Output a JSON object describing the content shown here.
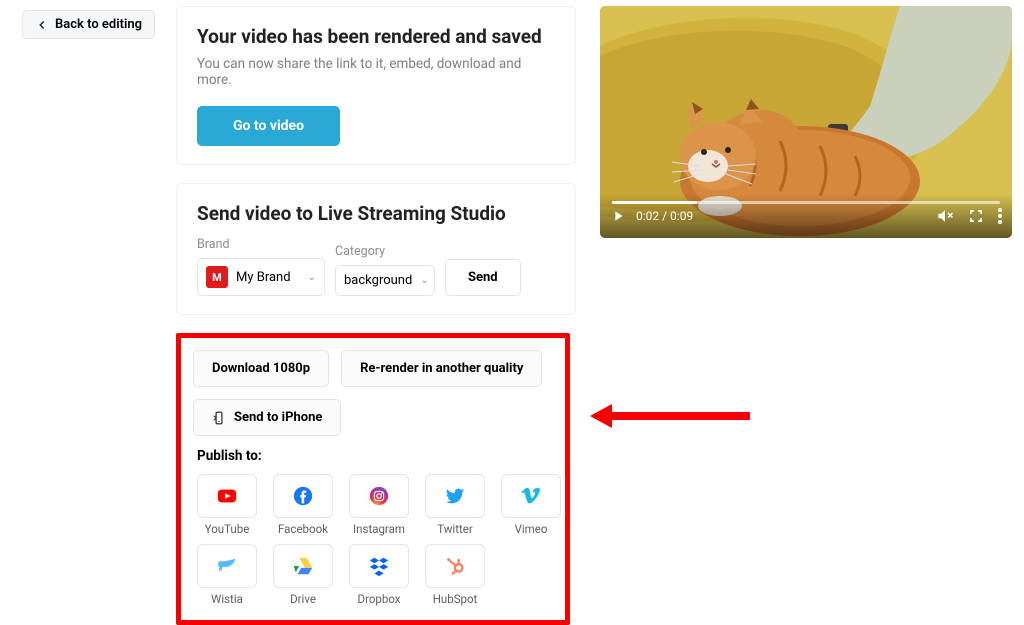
{
  "back_label": "Back to editing",
  "rendered": {
    "title": "Your video has been rendered and saved",
    "subtitle": "You can now share the link to it, embed, download and more.",
    "go_label": "Go to video"
  },
  "live": {
    "title": "Send video to Live Streaming Studio",
    "brand_label": "Brand",
    "brand_value": "My Brand",
    "brand_initial": "M",
    "category_label": "Category",
    "category_value": "background",
    "send_label": "Send"
  },
  "actions": {
    "download_label": "Download 1080p",
    "rerender_label": "Re-render in another quality",
    "send_iphone_label": "Send to iPhone"
  },
  "publish_label": "Publish to:",
  "publish_targets": [
    "YouTube",
    "Facebook",
    "Instagram",
    "Twitter",
    "Vimeo",
    "Wistia",
    "Drive",
    "Dropbox",
    "HubSpot"
  ],
  "player": {
    "time": "0:02 / 0:09"
  }
}
